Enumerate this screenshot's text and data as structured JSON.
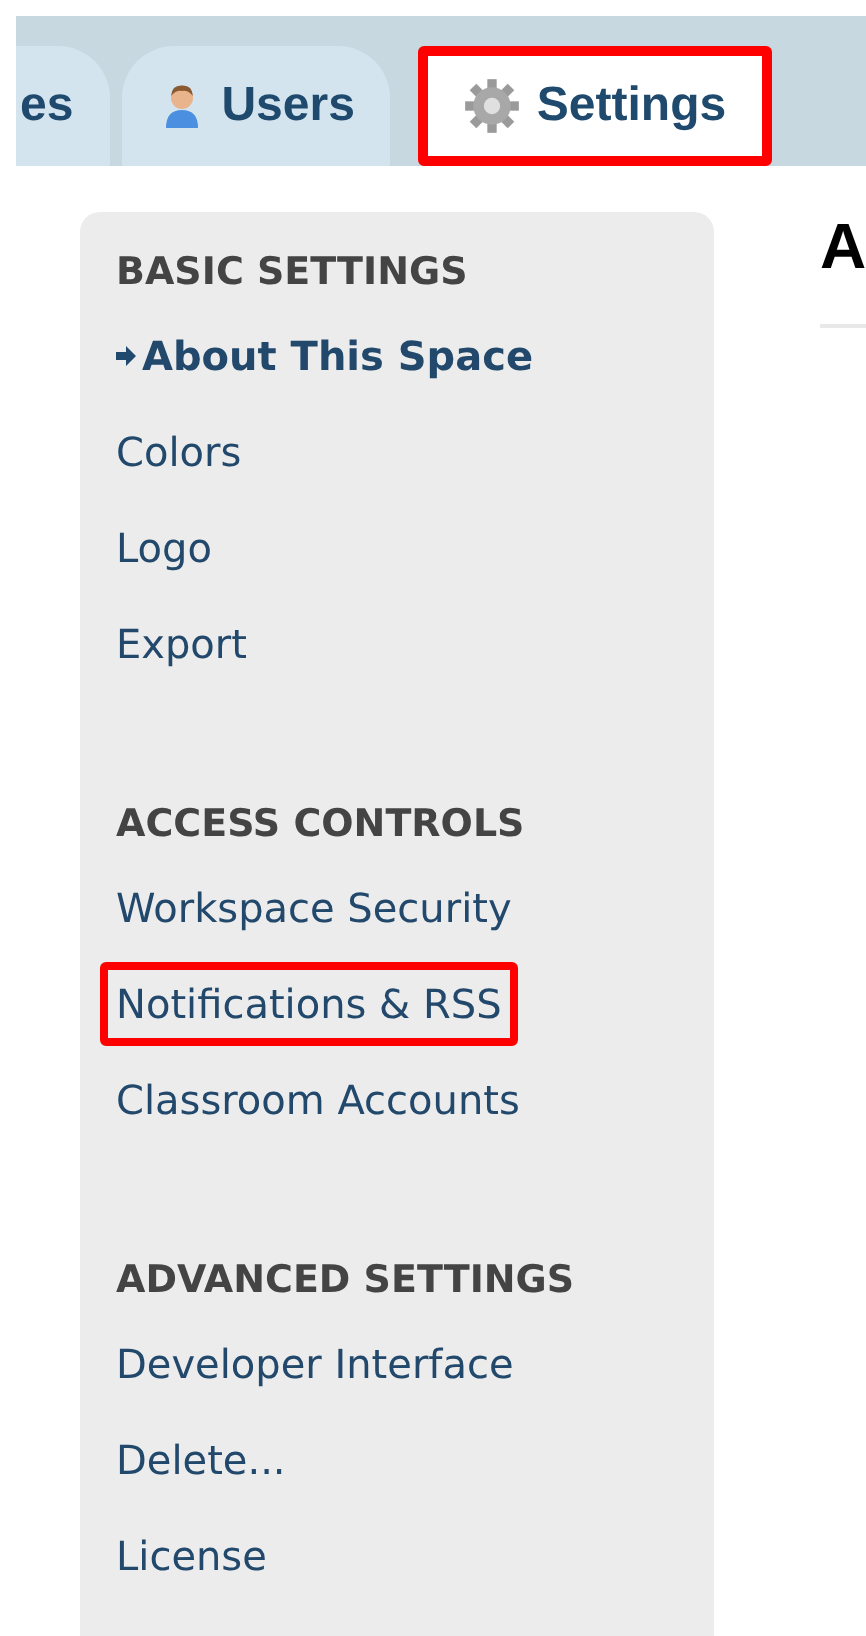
{
  "tabs": [
    {
      "label": "es",
      "selected": false,
      "highlighted": false
    },
    {
      "label": "Users",
      "kind": "user",
      "selected": false,
      "highlighted": false
    },
    {
      "label": "Settings",
      "kind": "gear",
      "selected": true,
      "highlighted": true
    }
  ],
  "sidebar": {
    "sections": [
      {
        "heading": "BASIC SETTINGS",
        "items": [
          {
            "label": "About This Space",
            "selected": true,
            "highlighted": false
          },
          {
            "label": "Colors",
            "selected": false,
            "highlighted": false
          },
          {
            "label": "Logo",
            "selected": false,
            "highlighted": false
          },
          {
            "label": "Export",
            "selected": false,
            "highlighted": false
          }
        ]
      },
      {
        "heading": "ACCESS CONTROLS",
        "items": [
          {
            "label": "Workspace Security",
            "selected": false,
            "highlighted": false
          },
          {
            "label": "Notifications & RSS",
            "selected": false,
            "highlighted": true
          },
          {
            "label": "Classroom Accounts",
            "selected": false,
            "highlighted": false
          }
        ]
      },
      {
        "heading": "ADVANCED SETTINGS",
        "items": [
          {
            "label": "Developer Interface",
            "selected": false,
            "highlighted": false
          },
          {
            "label": "Delete...",
            "selected": false,
            "highlighted": false
          },
          {
            "label": "License",
            "selected": false,
            "highlighted": false
          }
        ]
      }
    ]
  },
  "content": {
    "title": "A"
  }
}
